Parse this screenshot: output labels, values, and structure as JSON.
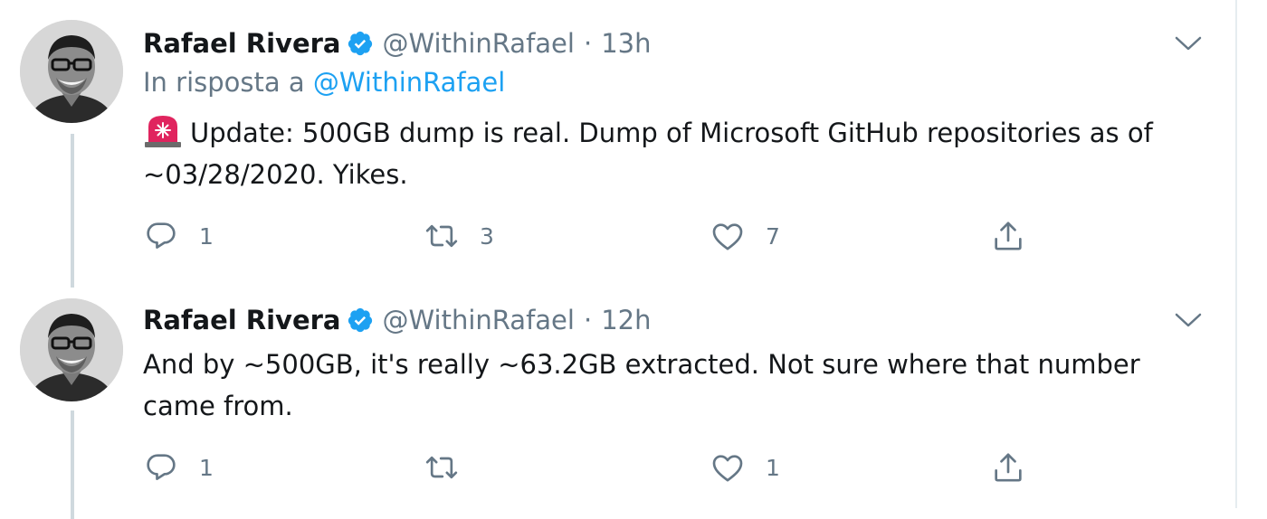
{
  "tweets": [
    {
      "display_name": "Rafael Rivera",
      "handle": "@WithinRafael",
      "separator": "·",
      "time": "13h",
      "reply_prefix": "In risposta a",
      "reply_mention": "@WithinRafael",
      "emoji": "rotating-light",
      "text": "Update: 500GB dump is real. Dump of Microsoft GitHub repositories as of ~03/28/2020. Yikes.",
      "replies": "1",
      "retweets": "3",
      "likes": "7"
    },
    {
      "display_name": "Rafael Rivera",
      "handle": "@WithinRafael",
      "separator": "·",
      "time": "12h",
      "text": "And by ~500GB, it's really ~63.2GB extracted. Not sure where that number came from.",
      "replies": "1",
      "retweets": "",
      "likes": "1"
    }
  ],
  "icons": {
    "verified": "verified-badge-icon",
    "caret": "chevron-down-icon",
    "reply": "reply-icon",
    "retweet": "retweet-icon",
    "like": "heart-icon",
    "share": "share-icon"
  },
  "colors": {
    "accent": "#1da1f2",
    "secondary_text": "#657786",
    "primary_text": "#14171a",
    "thread_line": "#cfd9de",
    "siren": "#e0245e"
  }
}
